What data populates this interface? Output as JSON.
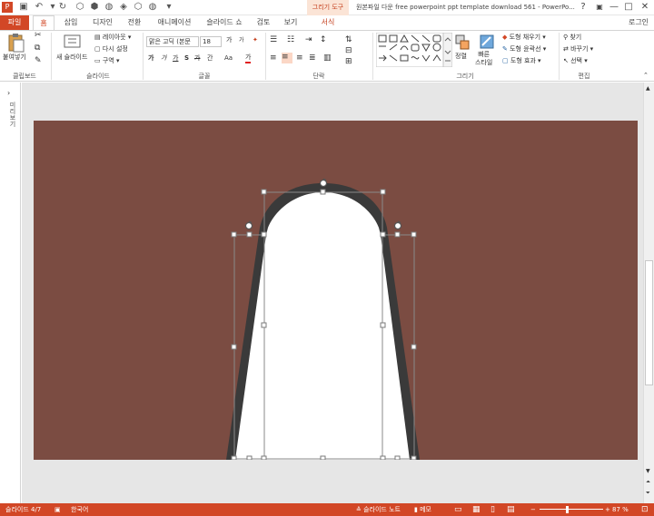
{
  "app": {
    "window_title": "원본파일 다운 free powerpoint ppt template download 561 - PowerPo...",
    "contextual_group": "그리기 도구",
    "signin": "로그인",
    "window_controls": [
      "?",
      "▣",
      "—",
      "□",
      "✕"
    ]
  },
  "tabs": [
    "파일",
    "홈",
    "삽입",
    "디자인",
    "전환",
    "애니메이션",
    "슬라이드 쇼",
    "검토",
    "보기",
    "서식"
  ],
  "ribbon": {
    "clipboard": {
      "paste": "붙여넣기",
      "label": "클립보드"
    },
    "slides": {
      "new_slide": "새 슬라이드",
      "layout": "레이아웃 ▾",
      "reset": "다시 설정",
      "section": "구역 ▾",
      "label": "슬라이드"
    },
    "font": {
      "font_name": "맑은 고딕 (본문",
      "font_size": "18",
      "grow": "가",
      "shrink": "가",
      "bold": "가",
      "italic": "가",
      "underline": "가",
      "strike": "S",
      "spacing": "간",
      "case": "Aa",
      "color": "가",
      "label": "글꼴"
    },
    "paragraph": {
      "label": "단락"
    },
    "drawing": {
      "arrange": "정렬",
      "quick_styles": "빠른\n스타일",
      "fill": "도형 채우기 ▾",
      "outline": "도형 윤곽선 ▾",
      "effects": "도형 효과 ▾",
      "label": "그리기"
    },
    "editing": {
      "find": "찾기",
      "replace": "바꾸기 ▾",
      "select": "선택 ▾",
      "label": "편집"
    }
  },
  "left_pane": {
    "label": "미리보기"
  },
  "status": {
    "slide": "슬라이드 4/7",
    "language": "한국어",
    "notes": "≙ 슬라이드 노트",
    "comments": "▮ 메모",
    "zoom": "87 %"
  },
  "colors": {
    "accent": "#d24726",
    "slide_bg": "#7b4c42",
    "shape_outline": "#3a3a3a",
    "shape_fill": "#ffffff"
  },
  "icons": [
    "save-icon",
    "undo-icon",
    "redo-icon",
    "paste-icon",
    "new-slide-icon",
    "find-icon",
    "replace-icon",
    "rotate-handle-icon"
  ]
}
